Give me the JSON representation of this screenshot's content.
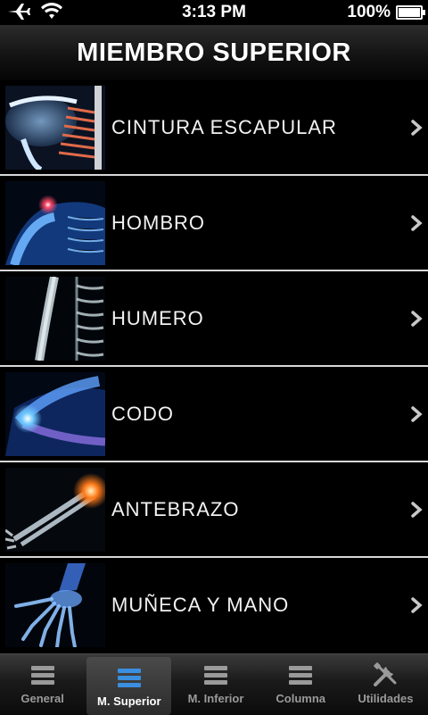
{
  "status_bar": {
    "time": "3:13 PM",
    "battery": "100%",
    "icons": [
      "airplane-icon",
      "wifi-icon",
      "battery-icon"
    ]
  },
  "header": {
    "title": "MIEMBRO SUPERIOR"
  },
  "list": {
    "items": [
      {
        "label": "CINTURA ESCAPULAR",
        "icon": "shoulder-girdle-xray-thumbnail"
      },
      {
        "label": "HOMBRO",
        "icon": "shoulder-xray-thumbnail"
      },
      {
        "label": "HUMERO",
        "icon": "humerus-xray-thumbnail"
      },
      {
        "label": "CODO",
        "icon": "elbow-xray-thumbnail"
      },
      {
        "label": "ANTEBRAZO",
        "icon": "forearm-xray-thumbnail"
      },
      {
        "label": "MUÑECA Y MANO",
        "icon": "wrist-hand-xray-thumbnail"
      }
    ]
  },
  "tabbar": {
    "tabs": [
      {
        "label": "General",
        "icon": "list-icon",
        "active": false
      },
      {
        "label": "M. Superior",
        "icon": "list-icon",
        "active": true
      },
      {
        "label": "M. Inferior",
        "icon": "list-icon",
        "active": false
      },
      {
        "label": "Columna",
        "icon": "list-icon",
        "active": false
      },
      {
        "label": "Utilidades",
        "icon": "tools-icon",
        "active": false
      }
    ]
  },
  "colors": {
    "active_tab_icon": "#3a8fe0",
    "xray_blue": "#3a7fe0",
    "highlight_red": "#e02a2a",
    "separator": "#d8d8d8"
  }
}
